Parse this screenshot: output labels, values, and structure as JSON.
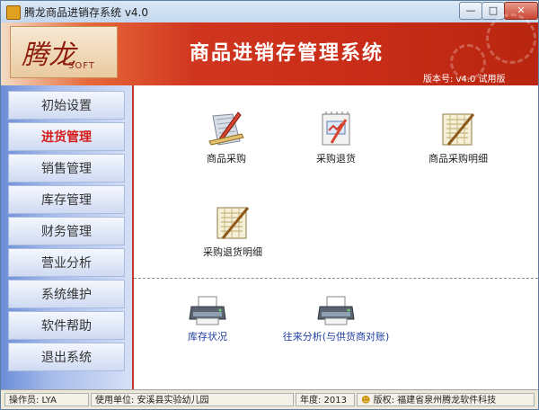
{
  "window": {
    "title": "腾龙商品进销存系统 v4.0",
    "min_glyph": "—",
    "max_glyph": "□",
    "close_glyph": "✕"
  },
  "banner": {
    "logo_main": "腾龙",
    "logo_sub": "SOFT",
    "system_title": "商品进销存管理系统",
    "version": "版本号: v4.0 试用版"
  },
  "sidebar": {
    "items": [
      {
        "label": "初始设置"
      },
      {
        "label": "进货管理",
        "active": true
      },
      {
        "label": "销售管理"
      },
      {
        "label": "库存管理"
      },
      {
        "label": "财务管理"
      },
      {
        "label": "营业分析"
      },
      {
        "label": "系统维护"
      },
      {
        "label": "软件帮助"
      },
      {
        "label": "退出系统"
      }
    ]
  },
  "main": {
    "functions": [
      {
        "label": "商品采购",
        "icon": "ruler-pencil-icon"
      },
      {
        "label": "采购退货",
        "icon": "return-sheet-icon"
      },
      {
        "label": "商品采购明细",
        "icon": "detail-sheet-icon"
      },
      {
        "label": "采购退货明细",
        "icon": "return-detail-icon"
      }
    ],
    "reports": [
      {
        "label": "库存状况",
        "icon": "printer-icon"
      },
      {
        "label": "往来分析(与供货商对账)",
        "icon": "printer-icon"
      }
    ]
  },
  "status": {
    "operator": "操作员: LYA",
    "unit": "使用单位: 安溪县实验幼儿园",
    "year": "年度: 2013",
    "copyright": "版权: 福建省泉州腾龙软件科技"
  },
  "colors": {
    "accent_red": "#c92d18",
    "active_menu": "#d51a1a",
    "link_blue": "#1f3fa3"
  }
}
